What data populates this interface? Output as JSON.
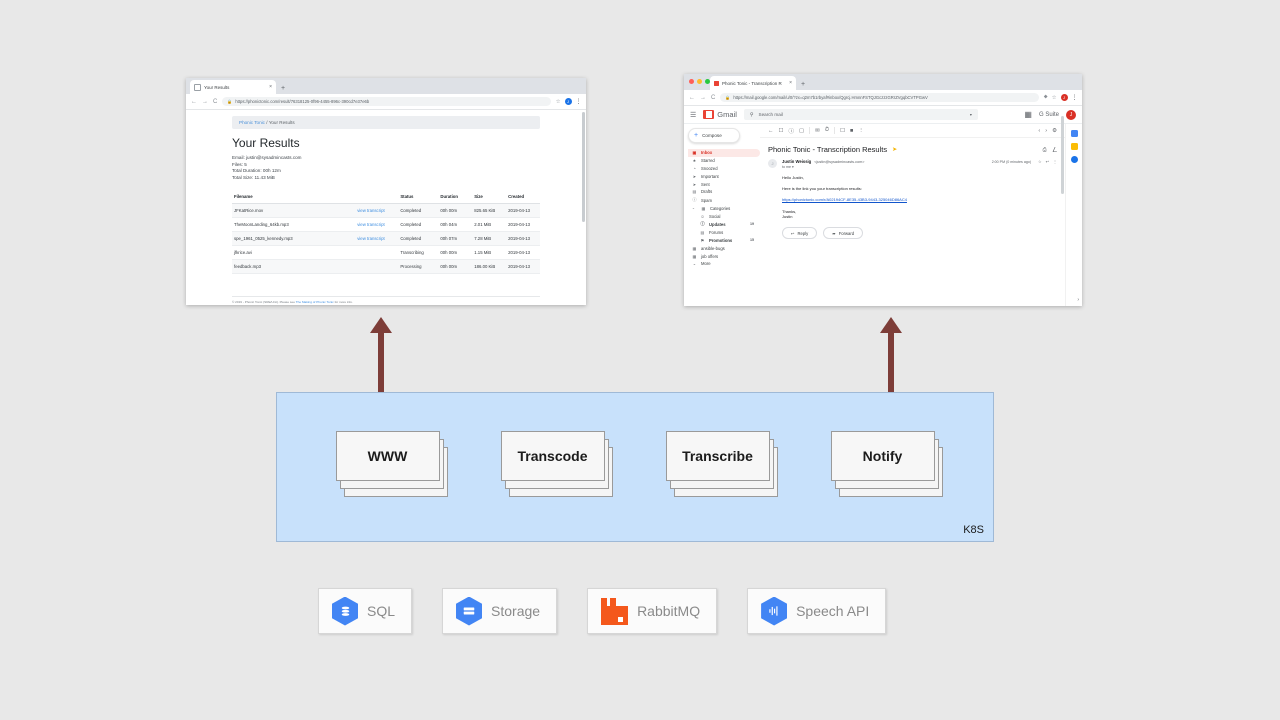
{
  "left_browser": {
    "tab": {
      "title": "Your Results",
      "favicon": "page-icon",
      "close": "×",
      "new_tab": "+"
    },
    "omnibox": {
      "back": "←",
      "forward": "→",
      "reload": "C",
      "lock": "🔒",
      "url": "https://phonictonic.com/result/76318125-0f96-4455-896c-390cd7e37e6b",
      "star": "☆",
      "profile_initial": "J",
      "menu": "⋮"
    },
    "page": {
      "breadcrumb_link": "Phonic Tonic",
      "breadcrumb_sep": "/",
      "breadcrumb_current": "Your Results",
      "title": "Your Results",
      "meta": [
        "Email: justin@sysadmincasts.com",
        "Files: 5",
        "Total Duration: 00h 12m",
        "Total Size: 11.43 MiB"
      ],
      "table": {
        "headers": [
          "Filename",
          "",
          "Status",
          "Duration",
          "Size",
          "Created"
        ],
        "rows": [
          {
            "filename": "JFKatRice.mov",
            "link": "view transcript",
            "status": "Completed",
            "duration": "00h 00m",
            "size": "825.65 KiB",
            "created": "2019-04-13"
          },
          {
            "filename": "TheMoonLanding_64kb.mp3",
            "link": "view transcript",
            "status": "Completed",
            "duration": "00h 04m",
            "size": "2.01 MiB",
            "created": "2019-04-13"
          },
          {
            "filename": "spe_1961_0525_kennedy.mp3",
            "link": "view transcript",
            "status": "Completed",
            "duration": "00h 07m",
            "size": "7.28 MiB",
            "created": "2019-04-13"
          },
          {
            "filename": "jfkrice.avi",
            "link": "",
            "status": "Transcribing",
            "duration": "00h 00m",
            "size": "1.15 MiB",
            "created": "2019-04-13"
          },
          {
            "filename": "feedback.mp3",
            "link": "",
            "status": "Processing",
            "duration": "00h 00m",
            "size": "186.00 KiB",
            "created": "2019-04-13"
          }
        ]
      },
      "footer_prefix": "© 2019 - Phonic Tonic (SRE/Unit). Please see",
      "footer_link": "The Making of Phonic Tonic",
      "footer_suffix": "for more info."
    }
  },
  "right_browser": {
    "tab": {
      "title": "Phonic Tonic - Transcription R",
      "close": "×",
      "new_tab": "+"
    },
    "omnibox": {
      "back": "←",
      "forward": "→",
      "reload": "C",
      "lock": "🔒",
      "url": "https://mail.google.com/mail/u/0/?zx=q2m7b1rbyaf#inbox/Qgrcj.HmnnFSTQJGczzzGRrZVgqbCVTPGwV",
      "extension": "⬥",
      "star": "☆",
      "profile_initial": "J",
      "menu": "⋮"
    },
    "gmail": {
      "hamburger": "☰",
      "logo_text": "Gmail",
      "search": {
        "icon": "search-icon",
        "placeholder": "Search mail",
        "caret": "▾"
      },
      "apps_icon": "apps-grid-icon",
      "suite_label": "G Suite",
      "avatar_initial": "J",
      "compose": "Compose",
      "nav": [
        {
          "icon": "▣",
          "label": "Inbox",
          "count": "",
          "active": true,
          "bold": true,
          "sub": false
        },
        {
          "icon": "★",
          "label": "Starred",
          "count": "",
          "active": false,
          "bold": false,
          "sub": false
        },
        {
          "icon": "◔",
          "label": "Snoozed",
          "count": "",
          "active": false,
          "bold": false,
          "sub": false
        },
        {
          "icon": "➤",
          "label": "Important",
          "count": "",
          "active": false,
          "bold": false,
          "sub": false
        },
        {
          "icon": "➤",
          "label": "Sent",
          "count": "",
          "active": false,
          "bold": false,
          "sub": false
        },
        {
          "icon": "▤",
          "label": "Drafts",
          "count": "",
          "active": false,
          "bold": false,
          "sub": false
        },
        {
          "icon": "ⓘ",
          "label": "Spam",
          "count": "",
          "active": false,
          "bold": false,
          "sub": false
        },
        {
          "icon": "▦",
          "label": "Categories",
          "count": "",
          "active": false,
          "bold": false,
          "sub": false
        },
        {
          "icon": "☺",
          "label": "Social",
          "count": "",
          "active": false,
          "bold": false,
          "sub": true
        },
        {
          "icon": "ⓘ",
          "label": "Updates",
          "count": "19",
          "active": false,
          "bold": true,
          "sub": true
        },
        {
          "icon": "▤",
          "label": "Forums",
          "count": "",
          "active": false,
          "bold": false,
          "sub": true
        },
        {
          "icon": "⚑",
          "label": "Promotions",
          "count": "15",
          "active": false,
          "bold": true,
          "sub": true
        },
        {
          "icon": "▦",
          "label": "ansible-bugs",
          "count": "",
          "active": false,
          "bold": false,
          "sub": false
        },
        {
          "icon": "▦",
          "label": "job offers",
          "count": "",
          "active": false,
          "bold": false,
          "sub": false
        },
        {
          "icon": "⌄",
          "label": "More",
          "count": "",
          "active": false,
          "bold": false,
          "sub": false
        }
      ],
      "toolbar_icons": [
        "back-arrow-icon",
        "archive-icon",
        "report-spam-icon",
        "delete-icon",
        "mark-unread-icon",
        "snooze-icon",
        "move-to-icon",
        "labels-icon",
        "more-options-icon"
      ],
      "pager": {
        "prev": "‹",
        "next": "›",
        "settings": "⚙"
      },
      "subject": "Phonic Tonic - Transcription Results",
      "subject_badge": "important-marker-icon",
      "print_icon": "print-icon",
      "popout_icon": "open-in-new-icon",
      "message": {
        "avatar_initial": "J",
        "from": "Justin Weissig",
        "email": "<justin@sysadmincasts.com>",
        "to": "to me ▾",
        "time": "2:00 PM (0 minutes ago)",
        "star": "☆",
        "reply_icon": "↩",
        "more_icon": "⋮",
        "greeting": "Hello Justin,",
        "line": "Here is the link you your transcription results:",
        "link": "https://phonictonic.com/r/A02194CF-8E35-43B3-9443-325046D86AC4",
        "signoff1": "Thanks,",
        "signoff2": "Justin"
      },
      "actions": [
        {
          "icon": "↩",
          "label": "Reply"
        },
        {
          "icon": "➦",
          "label": "Forward"
        }
      ],
      "addons": [
        "calendar-addon-icon",
        "keep-addon-icon",
        "tasks-addon-icon"
      ],
      "expand_arrow": "›"
    }
  },
  "diagram": {
    "arrows": [
      {
        "name": "www-arrow",
        "color": "#7d3d38"
      },
      {
        "name": "notify-arrow",
        "color": "#7d3d38"
      }
    ],
    "k8s": {
      "label": "K8S",
      "panel_color": "#c8e1fb",
      "services": [
        "WWW",
        "Transcode",
        "Transcribe",
        "Notify"
      ]
    },
    "chips": [
      {
        "label": "SQL",
        "icon": "google-sql-icon",
        "color": "#4285f4",
        "shape": "hex"
      },
      {
        "label": "Storage",
        "icon": "google-storage-icon",
        "color": "#4285f4",
        "shape": "hex"
      },
      {
        "label": "RabbitMQ",
        "icon": "rabbitmq-icon",
        "color": "#f4581c",
        "shape": "rabbit"
      },
      {
        "label": "Speech API",
        "icon": "google-speech-icon",
        "color": "#4285f4",
        "shape": "hex"
      }
    ]
  }
}
